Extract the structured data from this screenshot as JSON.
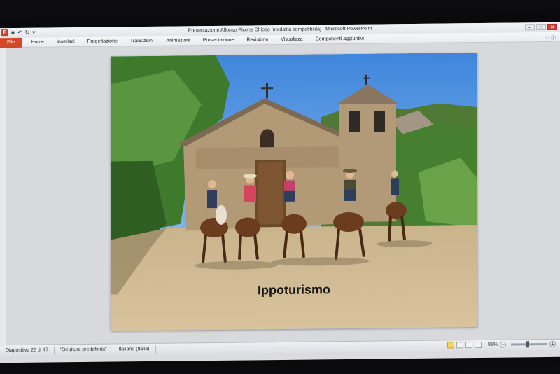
{
  "window": {
    "title": "Presentazione Alfonso Picone Chiodo [modalità compatibilità] - Microsoft PowerPoint"
  },
  "ribbon": {
    "tabs": [
      {
        "label": "File"
      },
      {
        "label": "Home"
      },
      {
        "label": "Inserisci"
      },
      {
        "label": "Progettazione"
      },
      {
        "label": "Transizioni"
      },
      {
        "label": "Animazioni"
      },
      {
        "label": "Presentazione"
      },
      {
        "label": "Revisione"
      },
      {
        "label": "Visualizza"
      },
      {
        "label": "Componenti aggiuntivi"
      }
    ]
  },
  "slide": {
    "caption": "Ippoturismo"
  },
  "statusbar": {
    "slide_indicator": "Diapositiva 28 di 47",
    "theme": "\"Struttura predefinita\"",
    "language": "Italiano (Italia)",
    "zoom": "91%"
  },
  "icons": {
    "app": "powerpoint-icon",
    "save": "save-icon",
    "undo": "undo-icon",
    "redo": "redo-icon"
  },
  "colors": {
    "file_tab": "#d24726",
    "sky": "#5b9be0"
  }
}
